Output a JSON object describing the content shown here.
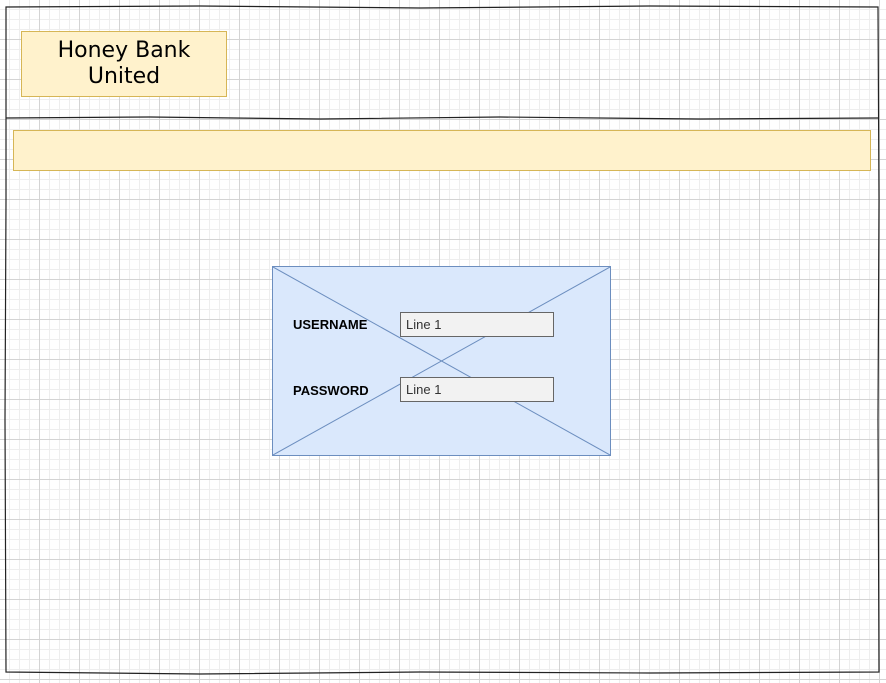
{
  "header": {
    "logo_line1": "Honey Bank",
    "logo_line2": "United"
  },
  "login": {
    "username_label": "USERNAME",
    "username_value": "Line 1",
    "password_label": "PASSWORD",
    "password_value": "Line 1"
  },
  "colors": {
    "logo_fill": "#fff2cc",
    "logo_stroke": "#d6b656",
    "panel_fill": "#dae8fc",
    "panel_stroke": "#6c8ebf",
    "input_fill": "#f2f2f2"
  }
}
